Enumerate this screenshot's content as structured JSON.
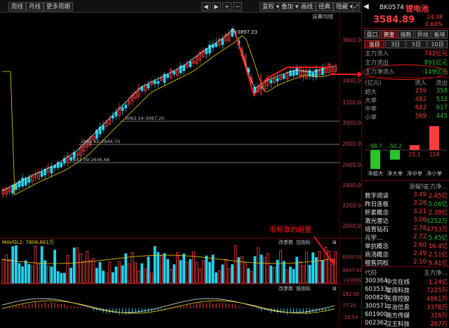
{
  "toolbar": {
    "week": "周线",
    "month": "月线",
    "more_periods": "更多周期",
    "reinstate": "复权",
    "overlay": "叠加",
    "draw_line": "画线",
    "classic": "经典",
    "hide": "隐藏",
    "settings_lines": "设置均线"
  },
  "chart": {
    "price_axis": [
      "3600.00",
      "3400.00",
      "3200.00",
      "3000.00",
      "2800.00",
      "2600.00",
      "2400.00",
      "2200.00",
      "2000.00"
    ],
    "annotations": {
      "high": "3897.23",
      "gap1": "3063.54-3067.20",
      "gap2": "2832.62-2844.70",
      "gap3": "2642.39-2646.68"
    },
    "volume": {
      "label": "MAVOL2: 7806.861万",
      "menu_params": "改参数",
      "menu_add": "加指标",
      "axis": [
        "6000.00",
        "4607.00",
        "×10000"
      ],
      "annotation_text": "很标准的缩量"
    },
    "macd": {
      "menu_params": "改参数",
      "menu_swap": "换指标",
      "axis": [
        "182.95",
        "77.21",
        "-28.54"
      ]
    }
  },
  "chart_data": {
    "type": "candlestick",
    "title": "BK0574 锂电池",
    "ylim": [
      1950,
      3950
    ],
    "marked_high": 3897.23,
    "gaps": [
      "3063.54-3067.20",
      "2832.62-2844.70",
      "2642.39-2646.68"
    ]
  },
  "panel": {
    "code": "BK0574",
    "name": "锂电池",
    "price": "3584.89",
    "change": "24.38",
    "change_pct": "0.68%",
    "tabs": [
      "盘口",
      "资金",
      "指数",
      "异动",
      "板块"
    ],
    "period_tabs": [
      "当日",
      "3日",
      "5日",
      "10日"
    ],
    "main_flow": [
      {
        "label": "主力流入",
        "value": "742亿元"
      },
      {
        "label": "主力流出",
        "value": "891亿元"
      },
      {
        "label": "主力净流入",
        "value": "-149亿元"
      }
    ],
    "order_header": {
      "unit": "(亿元)",
      "in": "流入",
      "out": "流出"
    },
    "orders": [
      {
        "label": "超大",
        "in": "259",
        "out": "358"
      },
      {
        "label": "大单",
        "in": "482",
        "out": "532"
      },
      {
        "label": "中单",
        "in": "642",
        "out": "617"
      },
      {
        "label": "小单",
        "in": "569",
        "out": "445"
      }
    ],
    "net_bars": [
      {
        "label": "净超大",
        "value": "-98.7"
      },
      {
        "label": "净大单",
        "value": "-50.2"
      },
      {
        "label": "净中单",
        "value": "25.1"
      },
      {
        "label": "净小单",
        "value": "124"
      }
    ],
    "sectors": [
      {
        "name": "数字阅读",
        "pct": "3.49",
        "flow": "2.45亿"
      },
      {
        "name": "昨日连板",
        "pct": "3.28",
        "flow": "-5.06亿"
      },
      {
        "name": "肝素概念",
        "pct": "3.21",
        "flow": "2.38亿"
      },
      {
        "name": "激光雷达",
        "pct": "3.06",
        "flow": "-5252万"
      },
      {
        "name": "培育钻石",
        "pct": "2.78",
        "flow": "4753万"
      },
      {
        "name": "元宇…",
        "pct": "2.72",
        "flow": "-5.45亿"
      },
      {
        "name": "单抗概念",
        "pct": "2.60",
        "flow": "16.4亿"
      },
      {
        "name": "商汤概念",
        "pct": "2.49",
        "flow": "2.51亿"
      },
      {
        "name": "租售同权",
        "pct": "2.10",
        "flow": "9.41亿"
      }
    ],
    "sector_header": {
      "pct": "涨幅%",
      "flow": "主力净…"
    },
    "stock_header": {
      "code": "代码",
      "flow": "主力净…"
    },
    "stocks": [
      {
        "code": "300364",
        "name": "中文在线",
        "flow": "1.24亿"
      },
      {
        "code": "603533",
        "name": "掌阅科技",
        "flow": "7225万"
      },
      {
        "code": "000829",
        "name": "天音控股",
        "flow": "4861万"
      },
      {
        "code": "300571",
        "name": "平治信息",
        "flow": "3378万"
      },
      {
        "code": "601900",
        "name": "南方传媒",
        "flow": "318万"
      },
      {
        "code": "002362",
        "name": "汉王科技",
        "flow": "267万"
      }
    ]
  },
  "colors": {
    "up": "#ff3c3c",
    "down": "#22d3ee",
    "annotation": "#ff1a1a",
    "flow_down": "#2ec12e"
  }
}
